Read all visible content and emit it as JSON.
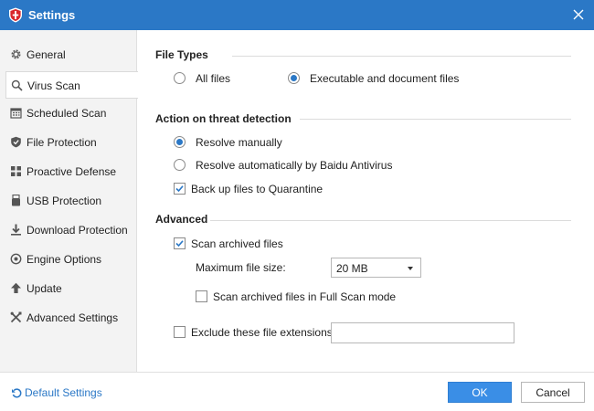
{
  "window": {
    "title": "Settings"
  },
  "sidebar": {
    "items": [
      {
        "label": "General",
        "icon": "gear-icon"
      },
      {
        "label": "Virus Scan",
        "icon": "search-icon",
        "active": true
      },
      {
        "label": "Scheduled Scan",
        "icon": "calendar-icon"
      },
      {
        "label": "File Protection",
        "icon": "shield-icon"
      },
      {
        "label": "Proactive Defense",
        "icon": "grid-icon"
      },
      {
        "label": "USB Protection",
        "icon": "usb-icon"
      },
      {
        "label": "Download Protection",
        "icon": "download-icon"
      },
      {
        "label": "Engine Options",
        "icon": "engine-icon"
      },
      {
        "label": "Update",
        "icon": "up-arrow-icon"
      },
      {
        "label": "Advanced Settings",
        "icon": "tools-icon"
      }
    ]
  },
  "file_types": {
    "title": "File Types",
    "options": [
      "All files",
      "Executable and document files"
    ],
    "selected": "Executable and document files"
  },
  "threat": {
    "title": "Action on threat detection",
    "options": [
      "Resolve manually",
      "Resolve automatically by Baidu Antivirus"
    ],
    "selected": "Resolve manually",
    "backup_label": "Back up files to Quarantine",
    "backup_checked": true
  },
  "advanced": {
    "title": "Advanced",
    "scan_archived_label": "Scan archived files",
    "scan_archived_checked": true,
    "max_size_label": "Maximum file size:",
    "max_size_value": "20 MB",
    "full_scan_label": "Scan archived files in Full Scan mode",
    "full_scan_checked": false,
    "exclude_label": "Exclude these file extensions:",
    "exclude_checked": false,
    "exclude_value": ""
  },
  "footer": {
    "default_label": "Default Settings",
    "ok_label": "OK",
    "cancel_label": "Cancel"
  },
  "colors": {
    "accent": "#2b78c6",
    "button": "#3a8ee6",
    "sidebar_bg": "#f3f3f3"
  }
}
